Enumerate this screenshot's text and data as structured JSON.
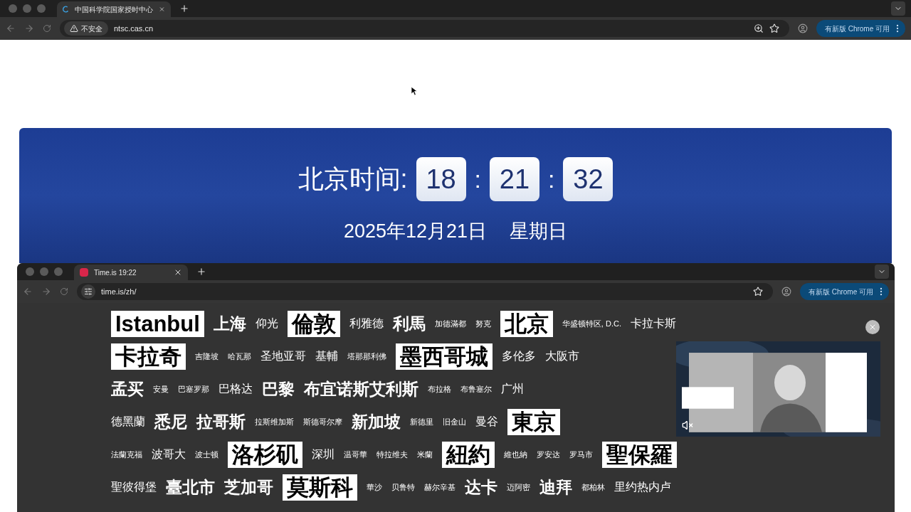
{
  "outer_browser": {
    "tab_title": "中国科学院国家授时中心",
    "security_label": "不安全",
    "url": "ntsc.cas.cn",
    "update_button": "有新版 Chrome 可用"
  },
  "banner": {
    "label": "北京时间:",
    "hours": "18",
    "minutes": "21",
    "seconds": "32",
    "separators": [
      ":",
      ":"
    ],
    "date": "2025年12月21日",
    "weekday": "星期日"
  },
  "inner_browser": {
    "tab_title": "Time.is 19:22",
    "url": "time.is/zh/",
    "update_button": "有新版 Chrome 可用"
  },
  "city_rows": [
    [
      {
        "text": "Istanbul",
        "kind": "boxed"
      },
      {
        "text": "上海",
        "kind": "large"
      },
      {
        "text": "仰光",
        "kind": "medium"
      },
      {
        "text": "倫敦",
        "kind": "boxed"
      },
      {
        "text": "利雅德",
        "kind": "medium"
      },
      {
        "text": "利馬",
        "kind": "large"
      },
      {
        "text": "加德滿都",
        "kind": "small"
      },
      {
        "text": "努克",
        "kind": "small"
      },
      {
        "text": "北京",
        "kind": "boxed"
      },
      {
        "text": "华盛顿特区, D.C.",
        "kind": "small"
      },
      {
        "text": "卡拉卡斯",
        "kind": "medium"
      }
    ],
    [
      {
        "text": "卡拉奇",
        "kind": "boxed"
      },
      {
        "text": "吉隆坡",
        "kind": "small"
      },
      {
        "text": "哈瓦那",
        "kind": "small"
      },
      {
        "text": "圣地亚哥",
        "kind": "medium"
      },
      {
        "text": "基輔",
        "kind": "medium"
      },
      {
        "text": "塔那那利佛",
        "kind": "small"
      },
      {
        "text": "墨西哥城",
        "kind": "boxed"
      },
      {
        "text": "多伦多",
        "kind": "medium"
      },
      {
        "text": "大阪市",
        "kind": "medium"
      }
    ],
    [
      {
        "text": "孟买",
        "kind": "large"
      },
      {
        "text": "安曼",
        "kind": "small"
      },
      {
        "text": "巴塞罗那",
        "kind": "small"
      },
      {
        "text": "巴格达",
        "kind": "medium"
      },
      {
        "text": "巴黎",
        "kind": "large"
      },
      {
        "text": "布宜诺斯艾利斯",
        "kind": "large"
      },
      {
        "text": "布拉格",
        "kind": "small"
      },
      {
        "text": "布鲁塞尔",
        "kind": "small"
      },
      {
        "text": "广州",
        "kind": "medium"
      }
    ],
    [
      {
        "text": "德黑蘭",
        "kind": "medium"
      },
      {
        "text": "悉尼",
        "kind": "large"
      },
      {
        "text": "拉哥斯",
        "kind": "large"
      },
      {
        "text": "拉斯维加斯",
        "kind": "small"
      },
      {
        "text": "斯德哥尔摩",
        "kind": "small"
      },
      {
        "text": "新加坡",
        "kind": "large"
      },
      {
        "text": "新德里",
        "kind": "small"
      },
      {
        "text": "旧金山",
        "kind": "small"
      },
      {
        "text": "曼谷",
        "kind": "medium"
      },
      {
        "text": "東京",
        "kind": "boxed"
      }
    ],
    [
      {
        "text": "法蘭克福",
        "kind": "small"
      },
      {
        "text": "波哥大",
        "kind": "medium"
      },
      {
        "text": "波士顿",
        "kind": "small"
      },
      {
        "text": "洛杉矶",
        "kind": "boxed"
      },
      {
        "text": "深圳",
        "kind": "medium"
      },
      {
        "text": "温哥華",
        "kind": "small"
      },
      {
        "text": "特拉维夫",
        "kind": "small"
      },
      {
        "text": "米蘭",
        "kind": "small"
      },
      {
        "text": "紐約",
        "kind": "boxed"
      },
      {
        "text": "維也納",
        "kind": "small"
      },
      {
        "text": "罗安达",
        "kind": "small"
      },
      {
        "text": "罗马市",
        "kind": "small"
      },
      {
        "text": "聖保羅",
        "kind": "boxed"
      }
    ],
    [
      {
        "text": "聖彼得堡",
        "kind": "medium"
      },
      {
        "text": "臺北市",
        "kind": "large"
      },
      {
        "text": "芝加哥",
        "kind": "large"
      },
      {
        "text": "莫斯科",
        "kind": "boxed"
      },
      {
        "text": "華沙",
        "kind": "small"
      },
      {
        "text": "贝鲁特",
        "kind": "small"
      },
      {
        "text": "赫尔辛基",
        "kind": "small"
      },
      {
        "text": "达卡",
        "kind": "large"
      },
      {
        "text": "迈阿密",
        "kind": "small"
      },
      {
        "text": "迪拜",
        "kind": "large"
      },
      {
        "text": "都柏林",
        "kind": "small"
      },
      {
        "text": "里约热内卢",
        "kind": "medium"
      }
    ]
  ]
}
